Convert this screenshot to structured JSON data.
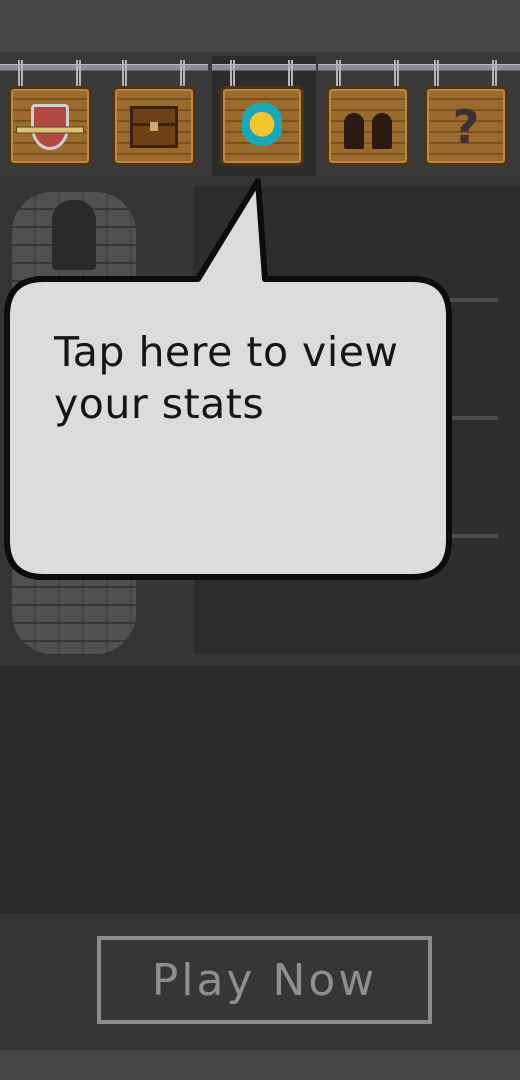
{
  "tabs": [
    {
      "icon": "armor-icon"
    },
    {
      "icon": "chest-icon"
    },
    {
      "icon": "stats-icon",
      "selected": true
    },
    {
      "icon": "party-icon"
    },
    {
      "icon": "help-icon"
    }
  ],
  "tooltip": {
    "line1": "Tap here to view",
    "line2": "your stats"
  },
  "help_symbol": "?",
  "play_button": {
    "label": "Play Now"
  },
  "colors": {
    "background": "#3a3a3a",
    "bubble_fill": "#dcdcdc",
    "bubble_stroke": "#0c0c0c",
    "button_border": "#8c8c8c",
    "wood": "#9b6a2d"
  }
}
